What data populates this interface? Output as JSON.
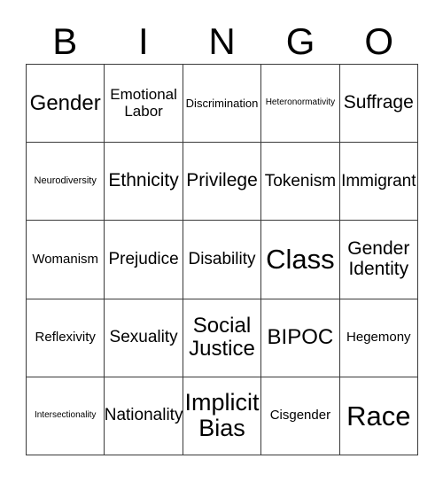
{
  "card": {
    "header_letters": [
      "B",
      "I",
      "N",
      "G",
      "O"
    ],
    "rows": [
      [
        {
          "label": "Gender",
          "size": "xl"
        },
        {
          "label": "Emotional Labor",
          "size": "m"
        },
        {
          "label": "Discrimination",
          "size": "s"
        },
        {
          "label": "Heteronormativity",
          "size": "xxs"
        },
        {
          "label": "Suffrage",
          "size": "l"
        }
      ],
      [
        {
          "label": "Neurodiversity",
          "size": "xs"
        },
        {
          "label": "Ethnicity",
          "size": "l"
        },
        {
          "label": "Privilege",
          "size": "l"
        },
        {
          "label": "Tokenism",
          "size": "ml"
        },
        {
          "label": "Immigrant",
          "size": "ml"
        }
      ],
      [
        {
          "label": "Womanism",
          "size": "sm"
        },
        {
          "label": "Prejudice",
          "size": "ml"
        },
        {
          "label": "Disability",
          "size": "ml"
        },
        {
          "label": "Class",
          "size": "huge"
        },
        {
          "label": "Gender Identity",
          "size": "l"
        }
      ],
      [
        {
          "label": "Reflexivity",
          "size": "sm"
        },
        {
          "label": "Sexuality",
          "size": "ml"
        },
        {
          "label": "Social Justice",
          "size": "xl"
        },
        {
          "label": "BIPOC",
          "size": "xl"
        },
        {
          "label": "Hegemony",
          "size": "sm"
        }
      ],
      [
        {
          "label": "Intersectionality",
          "size": "xxs"
        },
        {
          "label": "Nationality",
          "size": "ml"
        },
        {
          "label": "Implicit Bias",
          "size": "xxl"
        },
        {
          "label": "Cisgender",
          "size": "sm"
        },
        {
          "label": "Race",
          "size": "huge"
        }
      ]
    ]
  }
}
